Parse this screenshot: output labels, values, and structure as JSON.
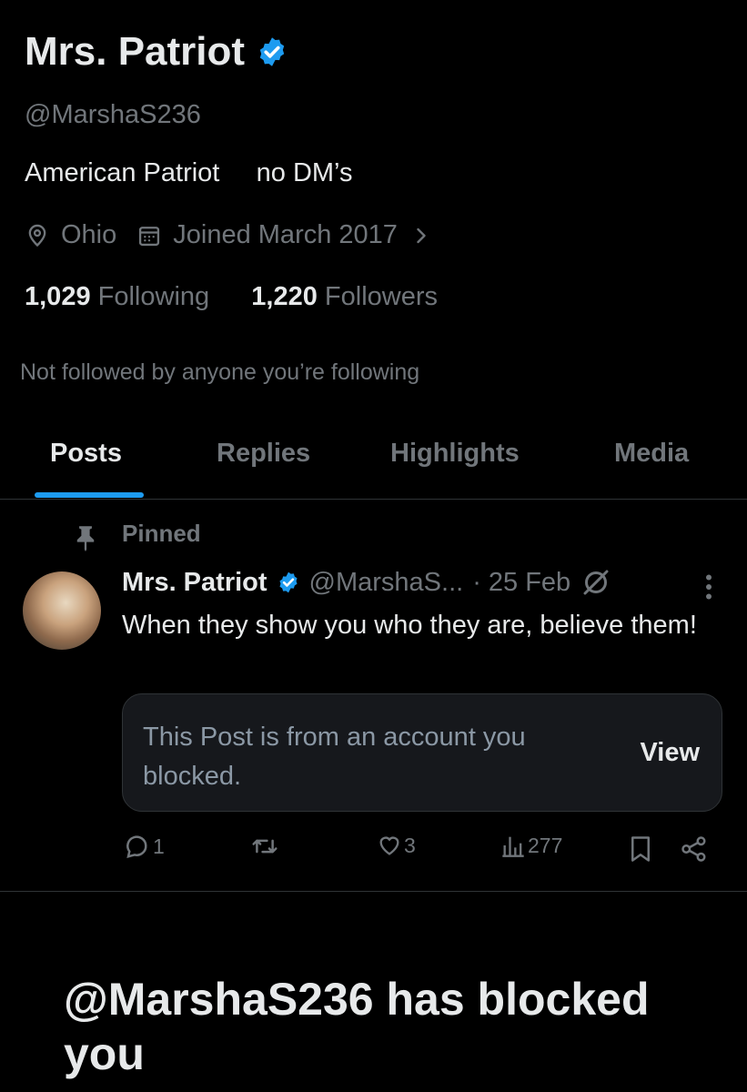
{
  "profile": {
    "display_name": "Mrs. Patriot",
    "handle": "@MarshaS236",
    "bio": "American Patriot     no DM’s",
    "location": "Ohio",
    "joined": "Joined March 2017",
    "following_count": "1,029",
    "following_label": "Following",
    "followers_count": "1,220",
    "followers_label": "Followers",
    "not_followed_text": "Not followed by anyone you’re following",
    "verified_icon": "verified-badge-icon",
    "accent_color": "#1d9bf0"
  },
  "tabs": [
    {
      "label": "Posts",
      "active": true
    },
    {
      "label": "Replies",
      "active": false
    },
    {
      "label": "Highlights",
      "active": false
    },
    {
      "label": "Media",
      "active": false
    }
  ],
  "pinned_post": {
    "pinned_label": "Pinned",
    "author_name": "Mrs. Patriot",
    "author_handle": "@MarshaS...",
    "date": "· 25 Feb",
    "text": "When they show you who they are, believe them!",
    "quoted_notice": "This Post is from an account you blocked.",
    "view_label": "View",
    "actions": {
      "replies": "1",
      "reposts": "",
      "likes": "3",
      "views": "277"
    }
  },
  "blocked_message": {
    "title": "@MarshaS236 has blocked you"
  }
}
